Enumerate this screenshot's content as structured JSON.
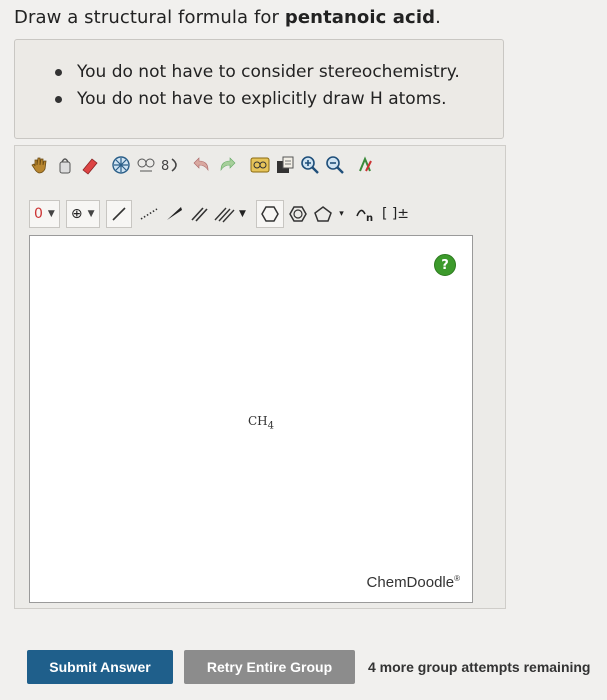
{
  "question": {
    "prefix": "Draw a structural formula for ",
    "compound": "pentanoic acid",
    "suffix": "."
  },
  "hints": [
    "You do not have to consider stereochemistry.",
    "You do not have to explicitly draw H atoms."
  ],
  "toolbar": {
    "charge_label": "0",
    "ring_more_label": "▾",
    "bracket_label": "[ ]±"
  },
  "canvas": {
    "help_label": "?",
    "molecule_label": "CH",
    "molecule_subscript": "4",
    "brand": "ChemDoodle",
    "brand_mark": "®"
  },
  "actions": {
    "submit": "Submit Answer",
    "retry": "Retry Entire Group",
    "remaining": "4 more group attempts remaining"
  },
  "colors": {
    "submit_bg": "#1f5f8b",
    "retry_bg": "#8c8c8c",
    "help_bg": "#3c9a2b"
  }
}
